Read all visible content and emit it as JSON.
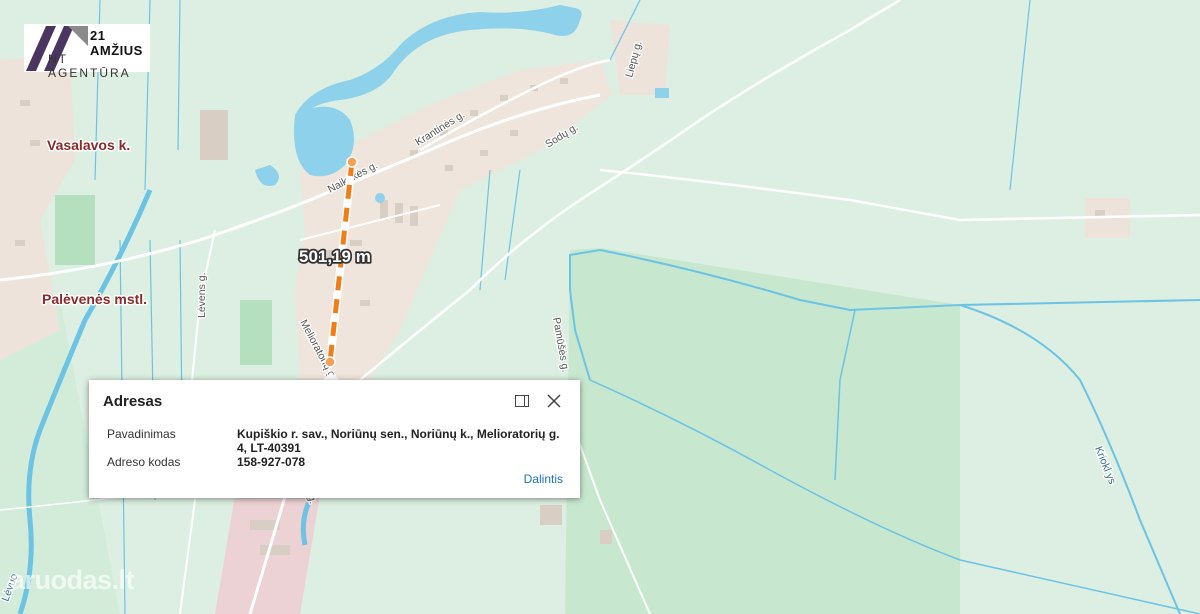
{
  "logo": {
    "line1": "21 AMŽIUS",
    "line2": "NT AGENTŪRA"
  },
  "places": [
    "Vasalavos k.",
    "Palėvenės mstl."
  ],
  "streets": [
    "Naikūkės g.",
    "Krantinės g.",
    "Sodų g.",
    "Liepų g.",
    "Lėvens g.",
    "Melioratorių g.",
    "Pamūšės g.",
    "g."
  ],
  "waterways": [
    "Kriokl ys",
    "Lėvuo"
  ],
  "measurement": {
    "label": "501,19 m",
    "line_color": "#f07d18"
  },
  "popup": {
    "title": "Adresas",
    "rows": [
      {
        "key": "Pavadinimas",
        "value": "Kupiškio r. sav., Noriūnų sen., Noriūnų k., Melioratorių g. 4, LT-40391"
      },
      {
        "key": "Adreso kodas",
        "value": "158-927-078"
      }
    ],
    "share_label": "Dalintis"
  },
  "watermark": "aruodas.lt",
  "colors": {
    "land": "#dcefe2",
    "forest": "#c7e8cf",
    "water": "#8dd1ea",
    "river": "#6cc3e4",
    "settlement": "#efe5dc",
    "accent": "#1a73c8"
  }
}
